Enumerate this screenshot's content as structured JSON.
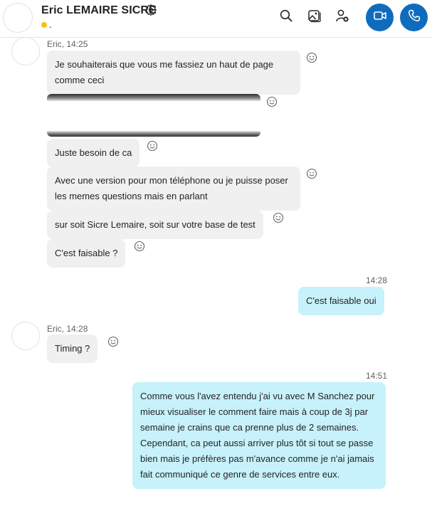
{
  "header": {
    "contact_name": "Eric LEMAIRE SICRE",
    "status_text": ".",
    "status_color": "#f8c200",
    "icons": [
      "gear-icon",
      "search-icon",
      "gallery-icon",
      "add-person-icon",
      "video-call-icon",
      "phone-icon"
    ],
    "accent_color": "#0f6cbd"
  },
  "groups": [
    {
      "sender": "Eric, 14:25"
    },
    {
      "time": "14:28"
    },
    {
      "sender": "Eric, 14:28"
    },
    {
      "time": "14:51"
    }
  ],
  "messages": [
    {
      "text": "Je souhaiterais que vous me fassiez un haut de page comme ceci"
    },
    {
      "text": "Juste besoin de ca"
    },
    {
      "text": "Avec une version pour mon téléphone ou je puisse poser les memes questions mais en parlant"
    },
    {
      "text": "sur soit Sicre Lemaire, soit sur votre base de test"
    },
    {
      "text": "C'est faisable ?"
    },
    {
      "text": "C'est faisable oui"
    },
    {
      "text": "Timing ?"
    },
    {
      "text": "Comme vous l'avez entendu j'ai vu avec M Sanchez pour mieux visualiser le comment faire mais à coup de 3j par semaine je crains que ca prenne plus de 2 semaines. Cependant, ca peut aussi arriver plus tôt si tout se passe bien mais je préfères pas m'avance comme je n'ai jamais fait communiqué ce genre de services entre eux."
    }
  ],
  "colors": {
    "incoming_bubble": "#f0f0f0",
    "outgoing_bubble": "#c7f1fb"
  }
}
